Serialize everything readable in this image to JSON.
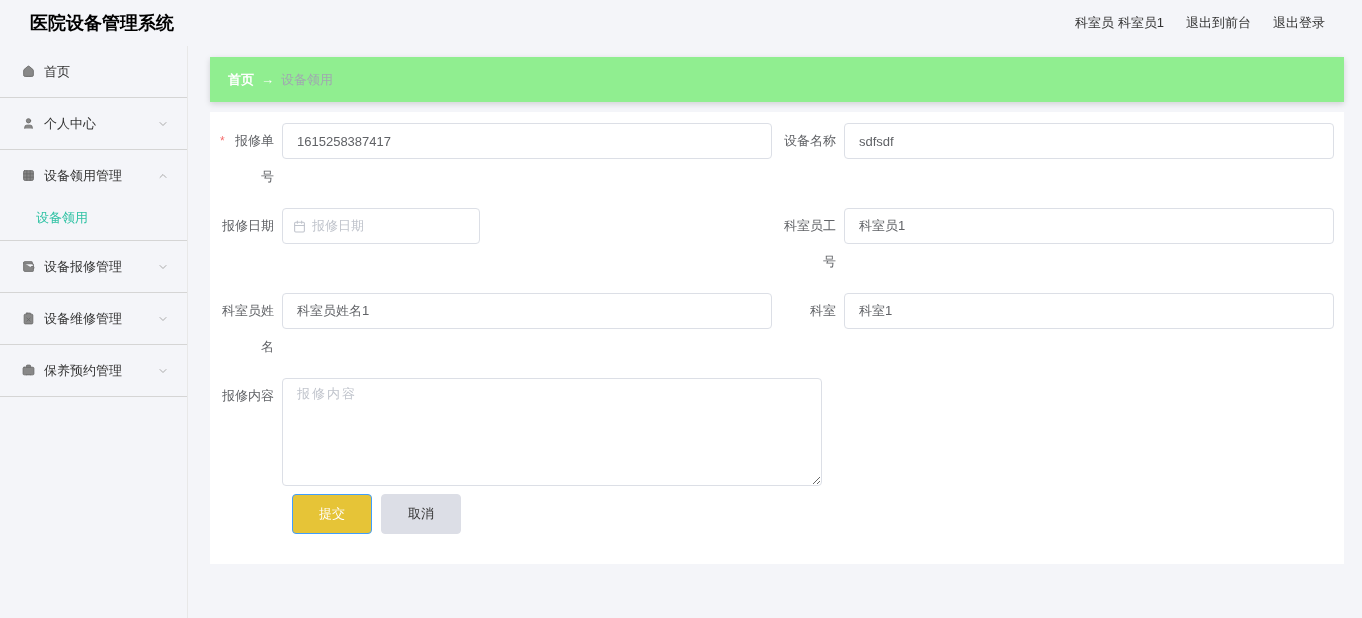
{
  "header": {
    "title": "医院设备管理系统",
    "user": "科室员 科室员1",
    "links": [
      "退出到前台",
      "退出登录"
    ]
  },
  "sidebar": {
    "items": [
      {
        "label": "首页",
        "kind": "link"
      },
      {
        "label": "个人中心",
        "kind": "menu",
        "expanded": false
      },
      {
        "label": "设备领用管理",
        "kind": "menu",
        "expanded": true,
        "children": [
          {
            "label": "设备领用",
            "selected": true
          }
        ]
      },
      {
        "label": "设备报修管理",
        "kind": "menu",
        "expanded": false
      },
      {
        "label": "设备维修管理",
        "kind": "menu",
        "expanded": false
      },
      {
        "label": "保养预约管理",
        "kind": "menu",
        "expanded": false
      }
    ]
  },
  "breadcrumb": {
    "home": "首页",
    "separator": "→",
    "current": "设备领用"
  },
  "form": {
    "fields": [
      {
        "label": "报修单号",
        "kind": "input",
        "required_mark": "*",
        "value": "1615258387417"
      },
      {
        "label": "设备名称",
        "kind": "input",
        "value": "sdfsdf"
      },
      {
        "label": "报修日期",
        "kind": "date",
        "placeholder": "报修日期"
      },
      {
        "label": "科室员工号",
        "kind": "input",
        "value": "科室员1"
      },
      {
        "label": "科室员姓名",
        "kind": "input",
        "value": "科室员姓名1"
      },
      {
        "label": "科室",
        "kind": "input",
        "value": "科室1"
      },
      {
        "label": "报修内容",
        "kind": "textarea",
        "placeholder": "报修内容"
      }
    ],
    "buttons": [
      {
        "label": "提交",
        "kind": "primary"
      },
      {
        "label": "取消",
        "kind": "secondary"
      }
    ]
  }
}
